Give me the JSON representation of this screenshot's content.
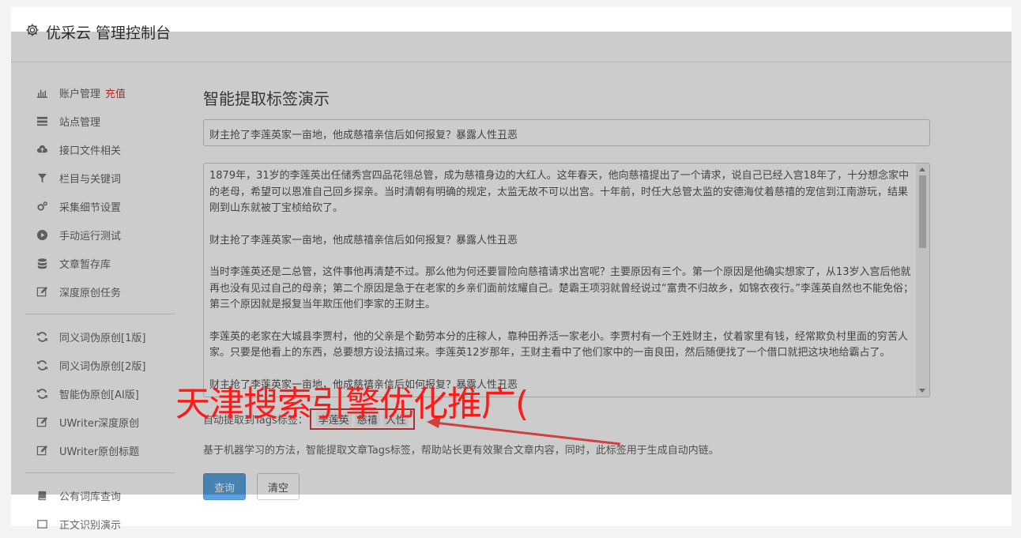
{
  "header": {
    "title": "优采云 管理控制台",
    "icon": "gear-icon"
  },
  "sidebar": {
    "group1": [
      {
        "label": "账户管理",
        "badge": "充值",
        "icon": "bar-chart-icon"
      },
      {
        "label": "站点管理",
        "icon": "list-icon"
      },
      {
        "label": "接口文件相关",
        "icon": "cloud-upload-icon"
      },
      {
        "label": "栏目与关键词",
        "icon": "filter-icon"
      },
      {
        "label": "采集细节设置",
        "icon": "gears-icon"
      },
      {
        "label": "手动运行测试",
        "icon": "play-circle-icon"
      },
      {
        "label": "文章暂存库",
        "icon": "database-icon"
      },
      {
        "label": "深度原创任务",
        "icon": "edit-icon"
      }
    ],
    "group2": [
      {
        "label": "同义词伪原创[1版]",
        "icon": "refresh-icon"
      },
      {
        "label": "同义词伪原创[2版]",
        "icon": "refresh-icon"
      },
      {
        "label": "智能伪原创[AI版]",
        "icon": "refresh-icon"
      },
      {
        "label": "UWriter深度原创",
        "icon": "edit-icon"
      },
      {
        "label": "UWriter原创标题",
        "icon": "edit-icon"
      }
    ],
    "group3": [
      {
        "label": "公有词库查询",
        "icon": "book-icon"
      },
      {
        "label": "正文识别演示",
        "icon": "square-icon"
      }
    ]
  },
  "main": {
    "title": "智能提取标签演示",
    "title_input_value": "财主抢了李莲英家一亩地，他成慈禧亲信后如何报复？暴露人性丑恶",
    "content_paragraphs": [
      "1879年，31岁的李莲英出任储秀宫四品花翎总管，成为慈禧身边的大红人。这年春天，他向慈禧提出了一个请求，说自己已经入宫18年了，十分想念家中的老母，希望可以恩准自己回乡探亲。当时清朝有明确的规定，太监无故不可以出宫。十年前，时任大总管太监的安德海仗着慈禧的宠信到江南游玩，结果刚到山东就被丁宝桢给砍了。",
      "财主抢了李莲英家一亩地，他成慈禧亲信后如何报复？暴露人性丑恶",
      "当时李莲英还是二总管，这件事他再清楚不过。那么他为何还要冒险向慈禧请求出宫呢？主要原因有三个。第一个原因是他确实想家了，从13岁入宫后他就再也没有见过自己的母亲；第二个原因是急于在老家的乡亲们面前炫耀自己。楚霸王项羽就曾经说过“富贵不归故乡，如锦衣夜行。”李莲英自然也不能免俗；第三个原因就是报复当年欺压他们李家的王财主。",
      "李莲英的老家在大城县李贾村，他的父亲是个勤劳本分的庄稼人，靠种田养活一家老小。李贾村有一个王姓财主，仗着家里有钱，经常欺负村里面的穷苦人家。只要是他看上的东西，总要想方设法搞过来。李莲英12岁那年，王财主看中了他们家中的一亩良田，然后随便找了一个借口就把这块地给霸占了。",
      "财主抢了李莲英家一亩地，他成慈禧亲信后如何报复？暴露人性丑恶"
    ],
    "tags_label": "自动提取到Tags标签：",
    "tags": [
      "李莲英",
      "慈禧",
      "人性"
    ],
    "description": "基于机器学习的方法，智能提取文章Tags标签，帮助站长更有效聚合文章内容，同时，此标签用于生成自动内链。",
    "query_button": "查询",
    "clear_button": "清空"
  },
  "watermark": {
    "text": "天津搜索引擎优化推广(",
    "color": "#ff1a1a"
  },
  "colors": {
    "primary": "#5aa3e0",
    "badge": "#e03030",
    "tag_border": "#d04040"
  }
}
